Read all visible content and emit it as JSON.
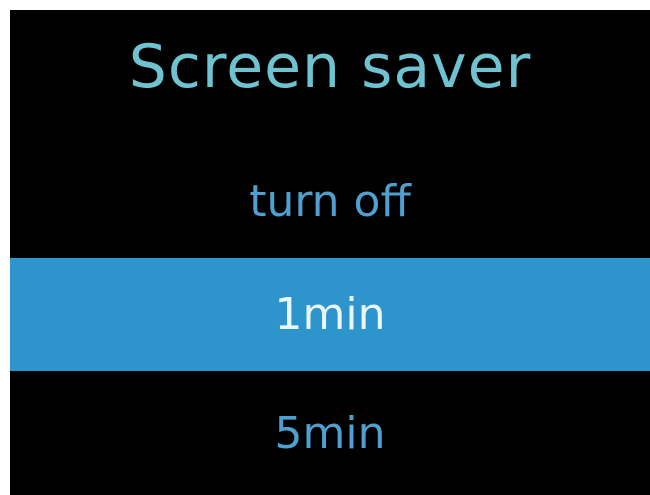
{
  "screen": {
    "title": "Screen saver"
  },
  "menu": {
    "items": [
      {
        "label": "turn off",
        "selected": false
      },
      {
        "label": "1min",
        "selected": true
      },
      {
        "label": "5min",
        "selected": false
      }
    ]
  },
  "colors": {
    "background": "#000000",
    "title": "#6fc3d0",
    "item_text": "#4f9fcf",
    "selected_background": "#2d94cc",
    "selected_text": "#e9f6fb"
  }
}
